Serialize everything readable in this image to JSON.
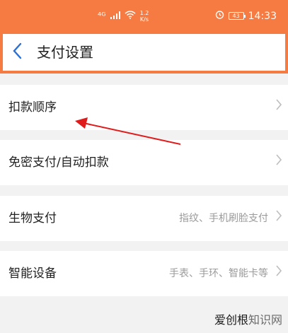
{
  "status_bar": {
    "signal_label": "⁴ᴳ",
    "speed_value": "1.2",
    "speed_unit": "K/s",
    "battery": "43",
    "time": "14:33",
    "icons": [
      "signal-icon",
      "wifi-icon",
      "alarm-icon",
      "battery-icon"
    ]
  },
  "header": {
    "title": "支付设置"
  },
  "rows": [
    {
      "label": "扣款顺序",
      "value": ""
    },
    {
      "label": "免密支付/自动扣款",
      "value": ""
    },
    {
      "label": "生物支付",
      "value": "指纹、手机刷脸支付"
    },
    {
      "label": "智能设备",
      "value": "手表、手环、智能卡等"
    }
  ],
  "watermark": {
    "brand": "爱创根",
    "suffix": "知识网"
  },
  "colors": {
    "accent": "#f57b42",
    "back_arrow": "#2a6fd6",
    "annotation_arrow": "#e01b1b"
  }
}
